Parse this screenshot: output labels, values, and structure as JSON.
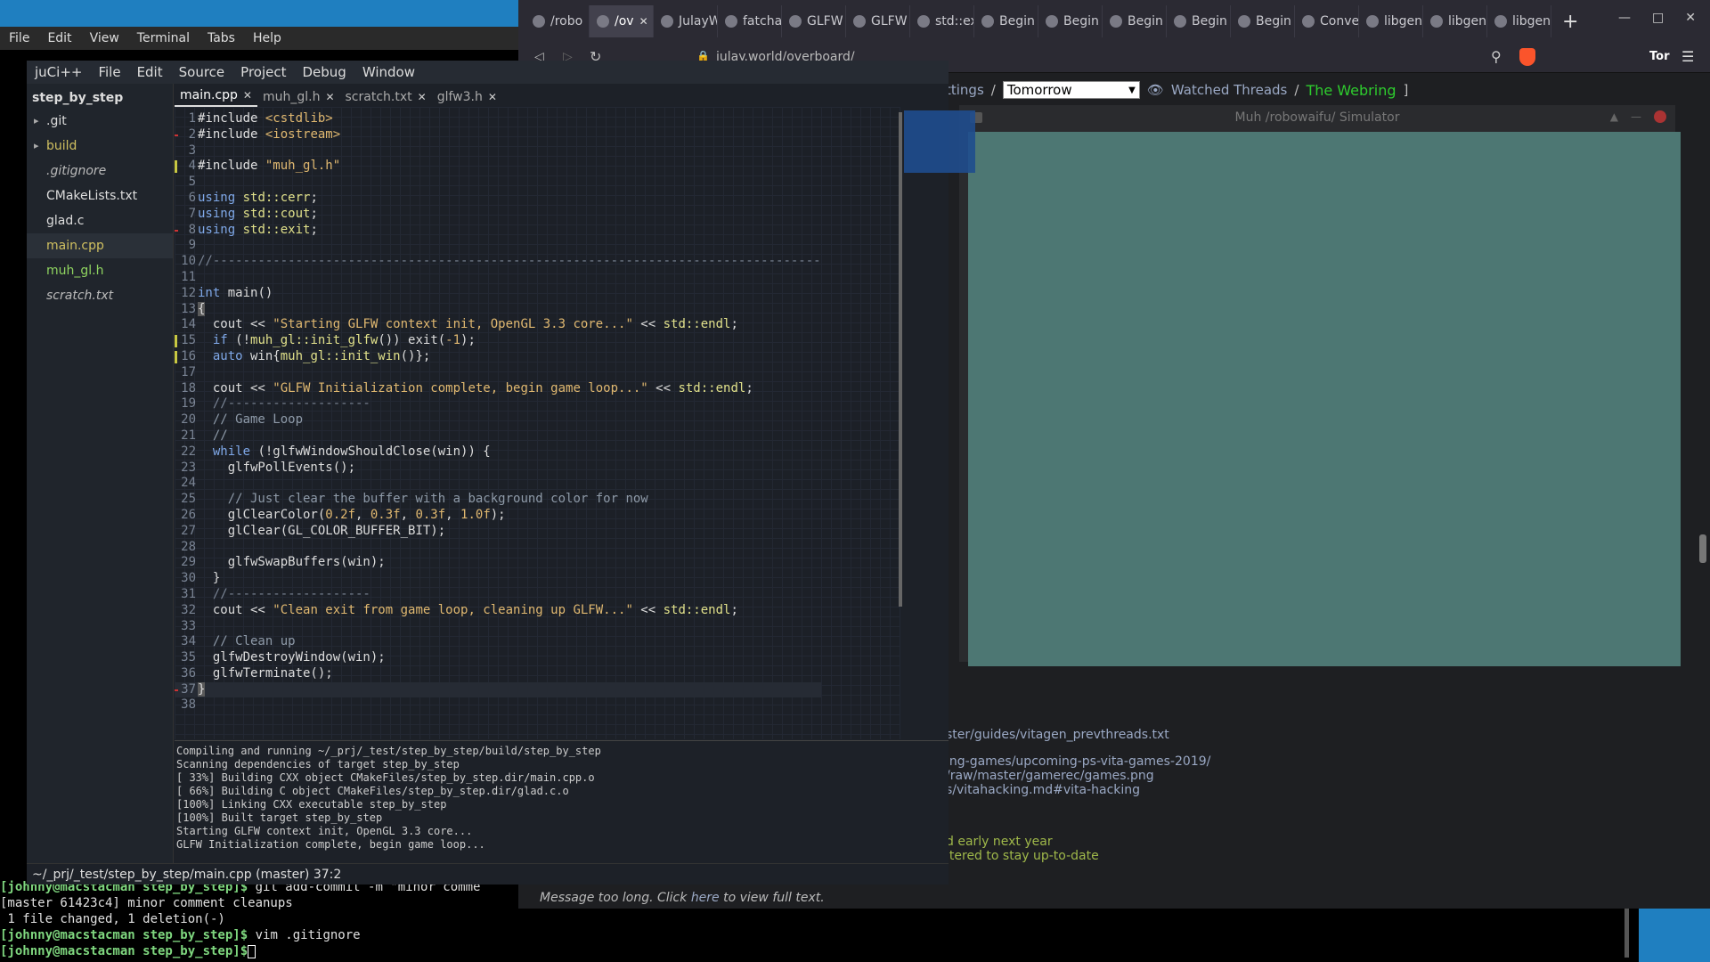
{
  "terminal": {
    "menu": [
      "File",
      "Edit",
      "View",
      "Terminal",
      "Tabs",
      "Help"
    ],
    "bottom_lines": [
      {
        "prompt": "[johnny@macstacman step_by_step]$",
        "text": " git add-commit -m \"minor comme"
      },
      {
        "prompt": "",
        "text": "[master 61423c4] minor comment cleanups"
      },
      {
        "prompt": "",
        "text": " 1 file changed, 1 deletion(-)"
      },
      {
        "prompt": "[johnny@macstacman step_by_step]$",
        "text": " vim .gitignore"
      },
      {
        "prompt": "[johnny@macstacman step_by_step]$",
        "text": " "
      }
    ]
  },
  "browser": {
    "tabs": [
      "/robo",
      "/ov",
      "JulayW",
      "fatcha",
      "GLFW",
      "GLFW",
      "std::ex",
      "Begin",
      "Begin",
      "Begin",
      "Begin",
      "Begin",
      "Conve",
      "libgen",
      "libgen",
      "libgen"
    ],
    "active_tab_index": 1,
    "url": "julay.world/overboard/",
    "tor_label": "Tor",
    "page": {
      "nav_settings": "ttings",
      "sep1": "/",
      "theme_selected": "Tomorrow",
      "watched_threads": "Watched Threads",
      "sep2": "/",
      "webring": "The Webring",
      "bracket": "]",
      "lines": [
        "ster/guides/vitagen_prevthreads.txt",
        "ing-games/upcoming-ps-vita-games-2019/",
        "/raw/master/gamerec/games.png",
        "s/vitahacking.md#vita-hacking"
      ],
      "green_lines": [
        "d early next year",
        "ltered to stay up-to-date"
      ],
      "footer_pre": "Message too long. Click ",
      "footer_link": "here",
      "footer_post": " to view full text."
    },
    "sim_window": {
      "title": "Muh /robowaifu/ Simulator",
      "canvas_color": "#4d7773"
    }
  },
  "ide": {
    "menu": [
      "juCi++",
      "File",
      "Edit",
      "Source",
      "Project",
      "Debug",
      "Window"
    ],
    "project": "step_by_step",
    "tree": [
      {
        "name": ".git",
        "type": "folder",
        "style": ""
      },
      {
        "name": "build",
        "type": "folder",
        "style": "modified"
      },
      {
        "name": ".gitignore",
        "type": "file",
        "style": "italic"
      },
      {
        "name": "CMakeLists.txt",
        "type": "file",
        "style": ""
      },
      {
        "name": "glad.c",
        "type": "file",
        "style": ""
      },
      {
        "name": "main.cpp",
        "type": "file",
        "style": "modified selected"
      },
      {
        "name": "muh_gl.h",
        "type": "file",
        "style": "green"
      },
      {
        "name": "scratch.txt",
        "type": "file",
        "style": "italic"
      }
    ],
    "tabs": [
      {
        "label": "main.cpp",
        "active": true
      },
      {
        "label": "muh_gl.h",
        "active": false
      },
      {
        "label": "scratch.txt",
        "active": false
      },
      {
        "label": "glfw3.h",
        "active": false
      }
    ],
    "output": [
      "Compiling and running ~/_prj/_test/step_by_step/build/step_by_step",
      "Scanning dependencies of target step_by_step",
      "[ 33%] Building CXX object CMakeFiles/step_by_step.dir/main.cpp.o",
      "[ 66%] Building C object CMakeFiles/step_by_step.dir/glad.c.o",
      "[100%] Linking CXX executable step_by_step",
      "[100%] Built target step_by_step",
      "Starting GLFW context init, OpenGL 3.3 core...",
      "GLFW Initialization complete, begin game loop..."
    ],
    "status": "~/_prj/_test/step_by_step/main.cpp (master) 37:2",
    "code": [
      "#include <cstdlib>",
      "#include <iostream>",
      "",
      "#include \"muh_gl.h\"",
      "",
      "using std::cerr;",
      "using std::cout;",
      "using std::exit;",
      "",
      "//---------------------------------------------------------------------------------",
      "",
      "int main()",
      "{",
      "  cout << \"Starting GLFW context init, OpenGL 3.3 core...\" << std::endl;",
      "  if (!muh_gl::init_glfw()) exit(-1);",
      "  auto win{muh_gl::init_win()};",
      "",
      "  cout << \"GLFW Initialization complete, begin game loop...\" << std::endl;",
      "  //-------------------",
      "  // Game Loop",
      "  //",
      "  while (!glfwWindowShouldClose(win)) {",
      "    glfwPollEvents();",
      "",
      "    // Just clear the buffer with a background color for now",
      "    glClearColor(0.2f, 0.3f, 0.3f, 1.0f);",
      "    glClear(GL_COLOR_BUFFER_BIT);",
      "",
      "    glfwSwapBuffers(win);",
      "  }",
      "  //-------------------",
      "  cout << \"Clean exit from game loop, cleaning up GLFW...\" << std::endl;",
      "",
      "  // Clean up",
      "  glfwDestroyWindow(win);",
      "  glfwTerminate();",
      "}",
      ""
    ]
  }
}
